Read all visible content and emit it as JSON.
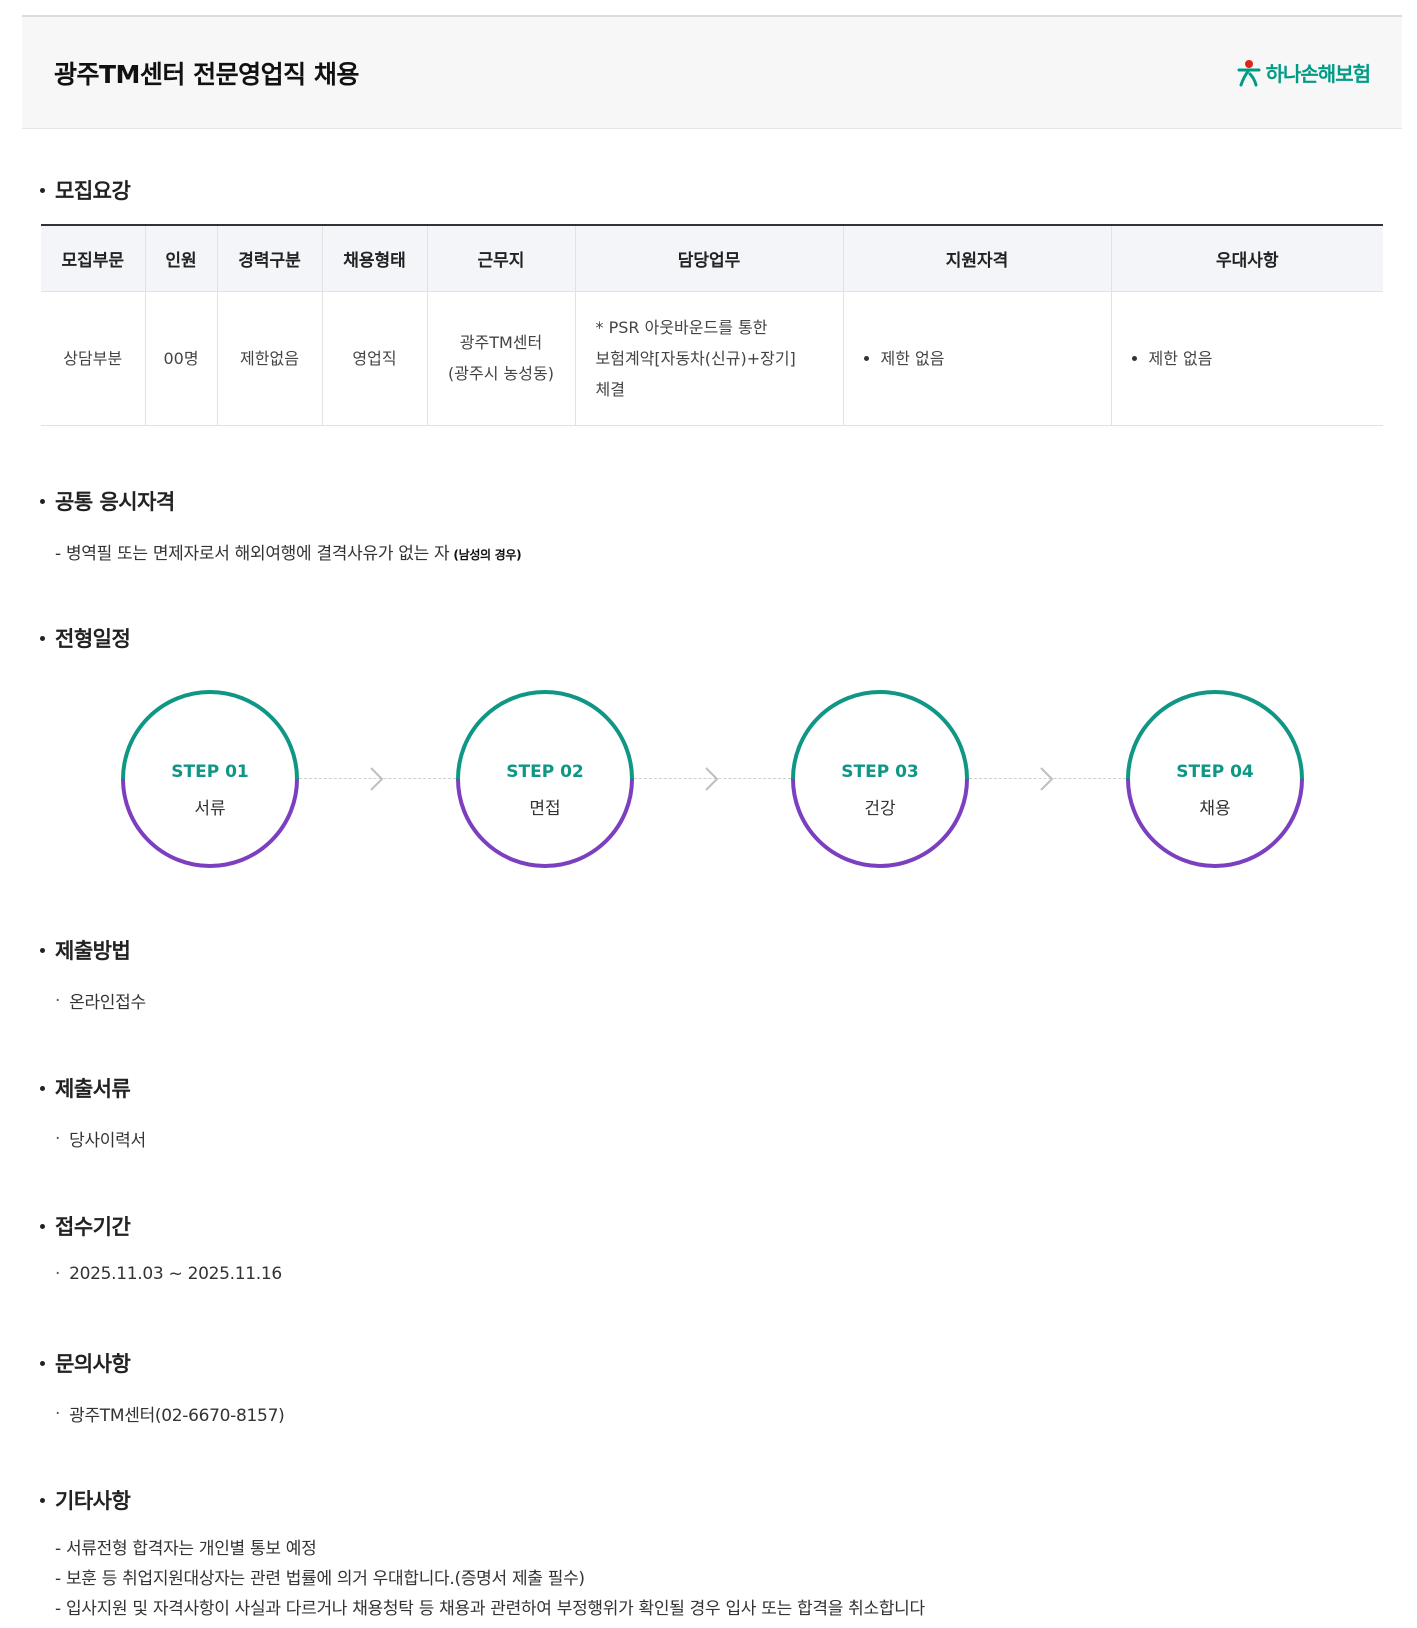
{
  "header": {
    "title": "광주TM센터 전문영업직 채용",
    "logo_text": "하나손해보험"
  },
  "sections": {
    "recruit": "모집요강",
    "common": "공통 응시자격",
    "schedule": "전형일정",
    "method": "제출방법",
    "documents": "제출서류",
    "period": "접수기간",
    "inquiry": "문의사항",
    "etc": "기타사항"
  },
  "table": {
    "headers": [
      "모집부문",
      "인원",
      "경력구분",
      "채용형태",
      "근무지",
      "담당업무",
      "지원자격",
      "우대사항"
    ],
    "row": {
      "division": "상담부분",
      "headcount": "00명",
      "career": "제한없음",
      "type": "영업직",
      "location_1": "광주TM센터",
      "location_2": "(광주시 농성동)",
      "duty_1": "* PSR 아웃바운드를 통한",
      "duty_2": "보험계약[자동차(신규)+장기]",
      "duty_3": "체결",
      "qualification": "제한 없음",
      "preference": "제한 없음"
    }
  },
  "common_qualification": {
    "text": "- 병역필 또는 면제자로서 해외여행에 결격사유가 없는 자",
    "note": "(남성의 경우)"
  },
  "steps": [
    {
      "no": "STEP 01",
      "name": "서류"
    },
    {
      "no": "STEP 02",
      "name": "면접"
    },
    {
      "no": "STEP 03",
      "name": "건강"
    },
    {
      "no": "STEP 04",
      "name": "채용"
    }
  ],
  "method_value": "온라인접수",
  "documents_value": "당사이력서",
  "period_value": "2025.11.03 ~ 2025.11.16",
  "inquiry_value": "광주TM센터(02-6670-8157)",
  "etc_lines": [
    "- 서류전형 합격자는 개인별 통보 예정",
    "- 보훈 등 취업지원대상자는 관련 법률에 의거 우대합니다.(증명서 제출 필수)",
    "- 입사지원 및 자격사항이 사실과 다르거나 채용청탁 등 채용과 관련하여 부정행위가 확인될 경우 입사 또는 합격을 취소합니다"
  ],
  "colors": {
    "teal": "#0f9685",
    "purple": "#7b3fbf",
    "logo_red": "#e2231a"
  },
  "icons": {
    "step_arrow": "chevron-right-icon",
    "logo": "hana-logo-icon"
  }
}
